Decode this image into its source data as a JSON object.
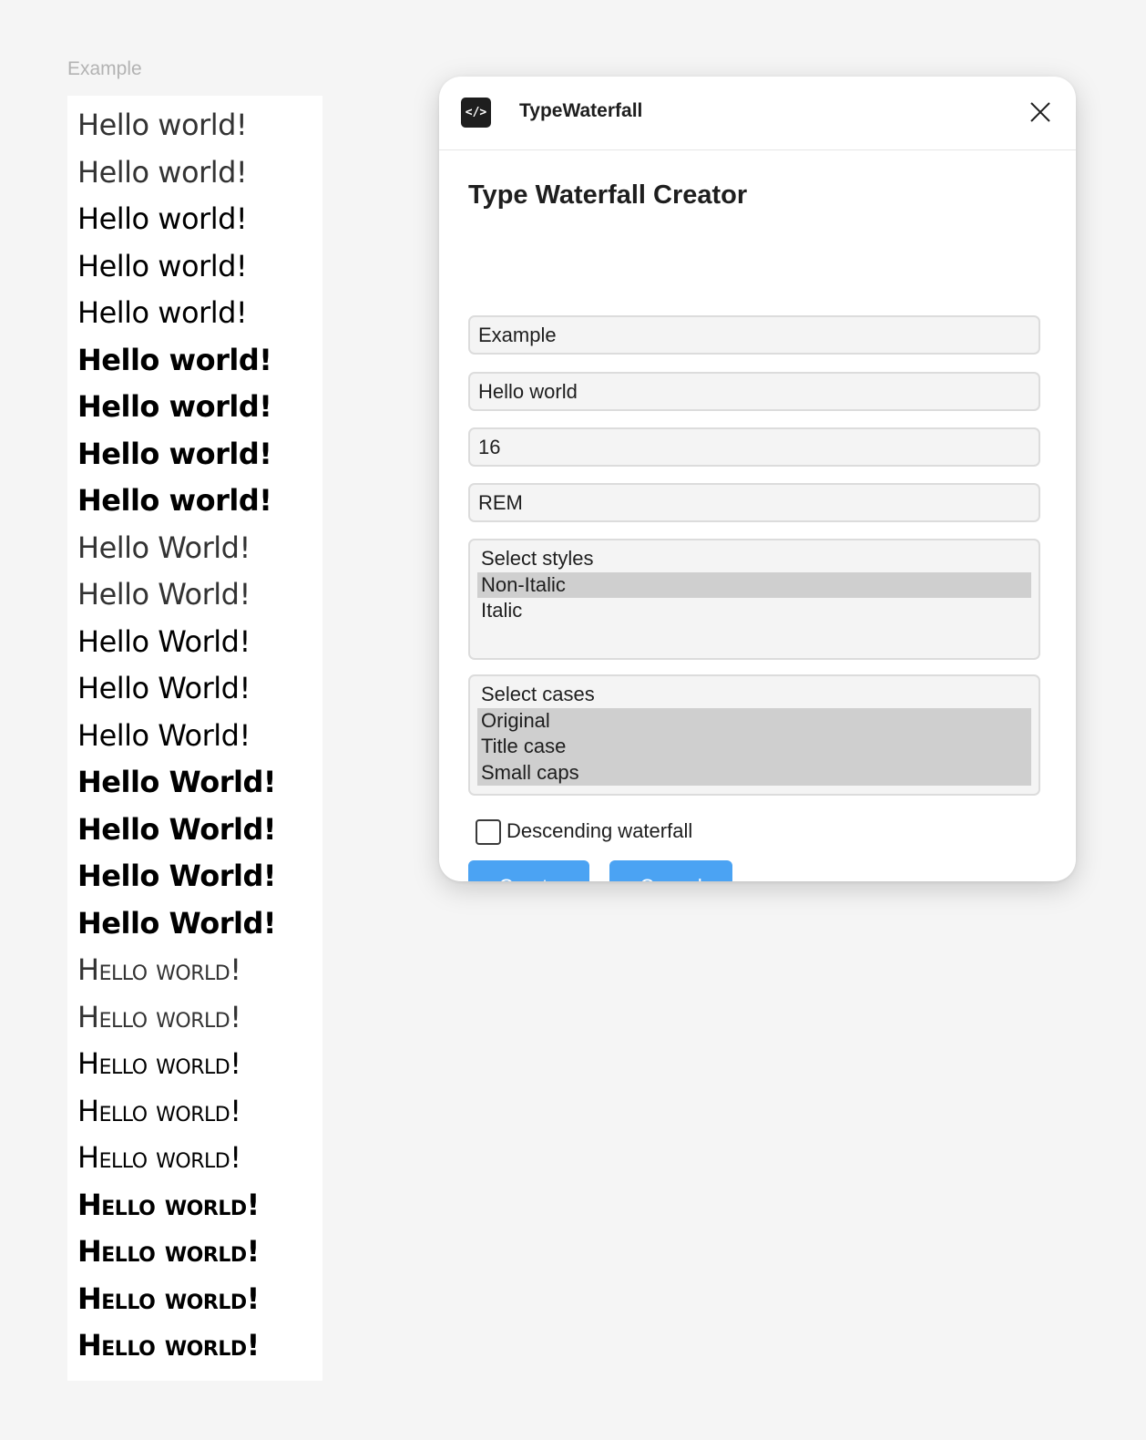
{
  "canvas": {
    "frame_label": "Example",
    "waterfall_lines": [
      {
        "text": "Hello world!",
        "weight": 100,
        "caps": false
      },
      {
        "text": "Hello world!",
        "weight": 200,
        "caps": false
      },
      {
        "text": "Hello world!",
        "weight": 300,
        "caps": false
      },
      {
        "text": "Hello world!",
        "weight": 400,
        "caps": false
      },
      {
        "text": "Hello world!",
        "weight": 500,
        "caps": false
      },
      {
        "text": "Hello world!",
        "weight": 600,
        "caps": false
      },
      {
        "text": "Hello world!",
        "weight": 700,
        "caps": false
      },
      {
        "text": "Hello world!",
        "weight": 800,
        "caps": false
      },
      {
        "text": "Hello world!",
        "weight": 900,
        "caps": false
      },
      {
        "text": "Hello World!",
        "weight": 100,
        "caps": false
      },
      {
        "text": "Hello World!",
        "weight": 200,
        "caps": false
      },
      {
        "text": "Hello World!",
        "weight": 300,
        "caps": false
      },
      {
        "text": "Hello World!",
        "weight": 400,
        "caps": false
      },
      {
        "text": "Hello World!",
        "weight": 500,
        "caps": false
      },
      {
        "text": "Hello World!",
        "weight": 600,
        "caps": false
      },
      {
        "text": "Hello World!",
        "weight": 700,
        "caps": false
      },
      {
        "text": "Hello World!",
        "weight": 800,
        "caps": false
      },
      {
        "text": "Hello World!",
        "weight": 900,
        "caps": false
      },
      {
        "text": "Hello world!",
        "weight": 100,
        "caps": true
      },
      {
        "text": "Hello world!",
        "weight": 200,
        "caps": true
      },
      {
        "text": "Hello world!",
        "weight": 300,
        "caps": true
      },
      {
        "text": "Hello world!",
        "weight": 400,
        "caps": true
      },
      {
        "text": "Hello world!",
        "weight": 500,
        "caps": true
      },
      {
        "text": "Hello world!",
        "weight": 600,
        "caps": true
      },
      {
        "text": "Hello world!",
        "weight": 700,
        "caps": true
      },
      {
        "text": "Hello world!",
        "weight": 800,
        "caps": true
      },
      {
        "text": "Hello world!",
        "weight": 900,
        "caps": true
      }
    ]
  },
  "plugin": {
    "app_icon": "code-icon",
    "app_icon_glyph": "</>",
    "title": "TypeWaterfall",
    "heading": "Type Waterfall Creator",
    "fields": {
      "name_value": "Example",
      "text_value": "Hello world",
      "size_value": "16",
      "unit_value": "REM"
    },
    "styles": {
      "placeholder": "Select styles",
      "options": [
        {
          "label": "Non-Italic",
          "selected": true
        },
        {
          "label": "Italic",
          "selected": false
        }
      ]
    },
    "cases": {
      "placeholder": "Select cases",
      "options": [
        {
          "label": "Original",
          "selected": true
        },
        {
          "label": "Title case",
          "selected": true
        },
        {
          "label": "Small caps",
          "selected": true
        }
      ]
    },
    "descending_label": "Descending waterfall",
    "descending_checked": false,
    "create_label": "Create",
    "cancel_label": "Cancel",
    "accent_color": "#4ba3f3"
  }
}
